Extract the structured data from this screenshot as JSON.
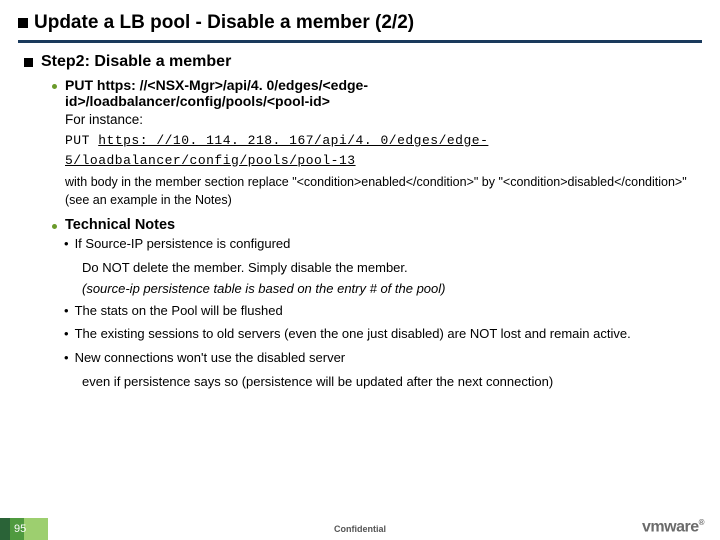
{
  "title": "Update a LB pool - Disable a member (2/2)",
  "step_title": "Step2: Disable a member",
  "put_line1": "PUT https: //<NSX-Mgr>/api/4. 0/edges/<edge-",
  "put_line2": "id>/loadbalancer/config/pools/<pool-id>",
  "for_instance": "For instance:",
  "code_prefix": "PUT ",
  "code_line1": "https: //10. 114. 218. 167/api/4. 0/edges/edge-",
  "code_line2": "5/loadbalancer/config/pools/pool-13",
  "body_note": "with body in the member section replace \"<condition>enabled</condition>\" by \"<condition>disabled</condition>\"(see an example in the Notes)",
  "tech_heading": "Technical Notes",
  "tech_item1": "If Source-IP persistence is configured",
  "tech_item1_sub1": "Do NOT delete the member. Simply disable the member.",
  "tech_item1_sub2": "(source-ip persistence table is based on the entry # of the pool)",
  "tech_item2": "The stats on the Pool will be flushed",
  "tech_item3": "The existing sessions to old servers (even the one just disabled) are NOT lost and remain active.",
  "tech_item4": "New connections won't use the disabled server",
  "tech_item4_sub": "even if persistence says so (persistence will be updated after the next connection)",
  "page_number": "95",
  "confidential": "Confidential",
  "logo_text": "vmware"
}
